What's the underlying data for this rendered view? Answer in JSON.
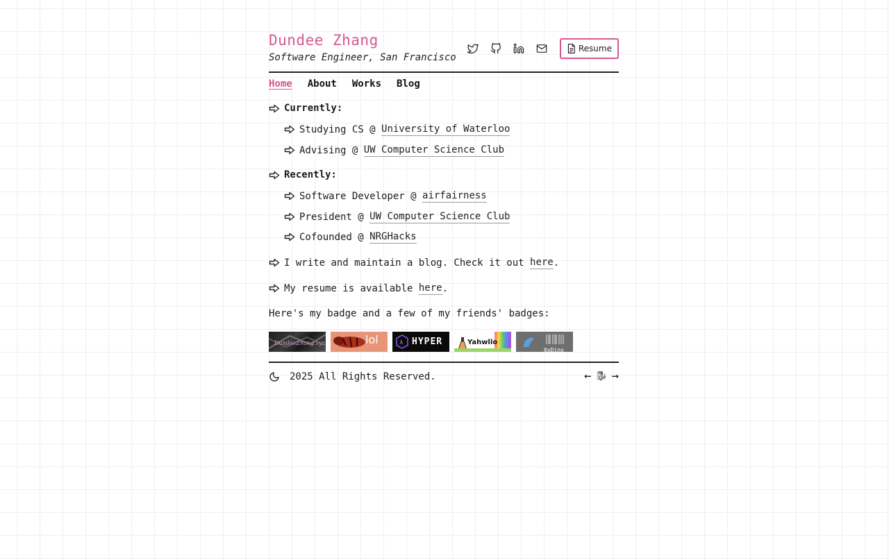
{
  "header": {
    "name": "Dundee Zhang",
    "subtitle": "Software Engineer, San Francisco",
    "resume_label": "Resume",
    "social_icons": [
      "twitter-icon",
      "github-icon",
      "linkedin-icon",
      "mail-icon"
    ]
  },
  "nav": {
    "items": [
      "Home",
      "About",
      "Works",
      "Blog"
    ],
    "active": "Home"
  },
  "currently": {
    "heading": "Currently:",
    "items": [
      {
        "prefix": "Studying CS @ ",
        "link": "University of Waterloo"
      },
      {
        "prefix": "Advising @ ",
        "link": "UW Computer Science Club"
      }
    ]
  },
  "recently": {
    "heading": "Recently:",
    "items": [
      {
        "prefix": "Software Developer @ ",
        "link": "airfairness"
      },
      {
        "prefix": "President @ ",
        "link": "UW Computer Science Club"
      },
      {
        "prefix": "Cofounded @ ",
        "link": "NRGHacks"
      }
    ]
  },
  "blog_line": {
    "prefix": "I write and maintain a blog. Check it out ",
    "link": "here",
    "suffix": "."
  },
  "resume_line": {
    "prefix": "My resume is available ",
    "link": "here",
    "suffix": "."
  },
  "badges_intro": "Here's my badge and a few of my friends' badges:",
  "badges": [
    {
      "text": "DundeeZhang.xyz"
    },
    {
      "text": "lol"
    },
    {
      "text": "HYPER"
    },
    {
      "text": "Yahwllo"
    },
    {
      "text": "0xDino"
    }
  ],
  "footer": {
    "copyright": "2025 All Rights Reserved.",
    "prev_symbol": "←",
    "ring_symbol": "🐉",
    "next_symbol": "→"
  },
  "colors": {
    "accent": "#d6578f",
    "text": "#1a1a1a"
  }
}
